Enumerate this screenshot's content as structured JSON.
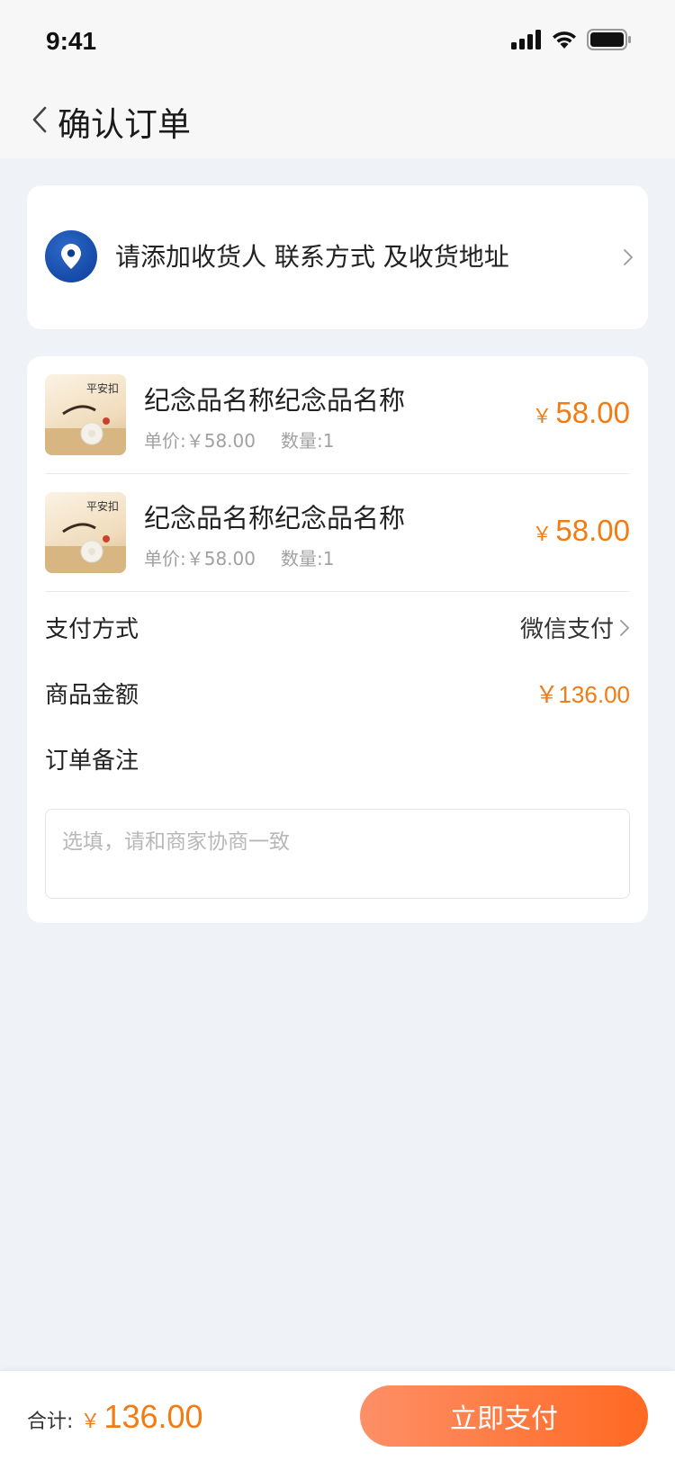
{
  "status_bar": {
    "time": "9:41"
  },
  "header": {
    "title": "确认订单",
    "back_icon": "chevron-left-icon"
  },
  "address": {
    "prompt": "请添加收货人 联系方式 及收货地址",
    "icon": "location-pin-icon"
  },
  "items": [
    {
      "name": "纪念品名称纪念品名称",
      "unit_price": "单价:￥58.00",
      "quantity": "数量:1",
      "currency": "￥",
      "price": "58.00",
      "thumb_caption": "平安扣"
    },
    {
      "name": "纪念品名称纪念品名称",
      "unit_price": "单价:￥58.00",
      "quantity": "数量:1",
      "currency": "￥",
      "price": "58.00",
      "thumb_caption": "平安扣"
    }
  ],
  "payment": {
    "label": "支付方式",
    "value": "微信支付"
  },
  "goods_amount": {
    "label": "商品金额",
    "value": "￥136.00"
  },
  "remark": {
    "label": "订单备注",
    "placeholder": "选填，请和商家协商一致",
    "value": ""
  },
  "footer": {
    "total_label": "合计:",
    "currency": "￥",
    "total": "136.00",
    "pay_button": "立即支付"
  },
  "colors": {
    "accent": "#f47a12",
    "button_start": "#fe8f67",
    "button_end": "#ff6922",
    "pin": "#0a3d98",
    "background": "#eff2f7"
  }
}
